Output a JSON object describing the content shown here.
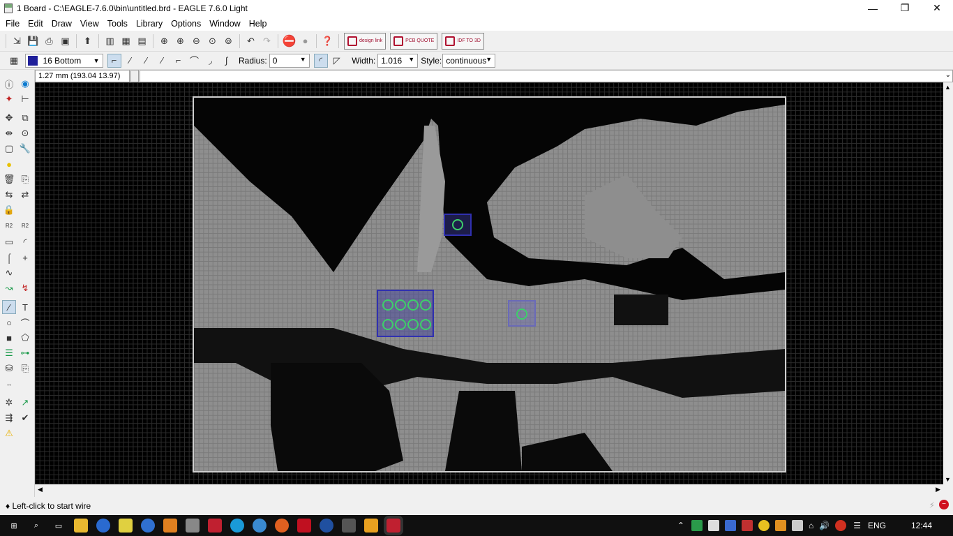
{
  "window": {
    "title": "1 Board - C:\\EAGLE-7.6.0\\bin\\untitled.brd - EAGLE 7.6.0 Light",
    "minimize": "—",
    "maximize": "❐",
    "close": "✕"
  },
  "menu": [
    "File",
    "Edit",
    "Draw",
    "View",
    "Tools",
    "Library",
    "Options",
    "Window",
    "Help"
  ],
  "toolbar": {
    "brand_buttons": [
      {
        "label": "design link",
        "icon": "design-link-icon"
      },
      {
        "label": "PCB QUOTE",
        "icon": "pcb-quote-icon"
      },
      {
        "label": "IDF TO 3D",
        "icon": "idf-to-3d-icon"
      }
    ]
  },
  "params": {
    "layer": "16 Bottom",
    "layer_color": "#1f1f9a",
    "radius_label": "Radius:",
    "radius_value": "0",
    "width_label": "Width:",
    "width_value": "1.016",
    "style_label": "Style:",
    "style_value": "continuous"
  },
  "command": {
    "coordinates": "1.27 mm (193.04 13.97)",
    "input": ""
  },
  "status": {
    "hint": "♦ Left-click to start wire"
  },
  "taskbar": {
    "language": "ENG",
    "clock": "12:44"
  },
  "colors": {
    "canvas_bg": "#000000",
    "board_fill": "#8e8e8e",
    "pad": "#3ed06a",
    "package": "#3030b0"
  }
}
